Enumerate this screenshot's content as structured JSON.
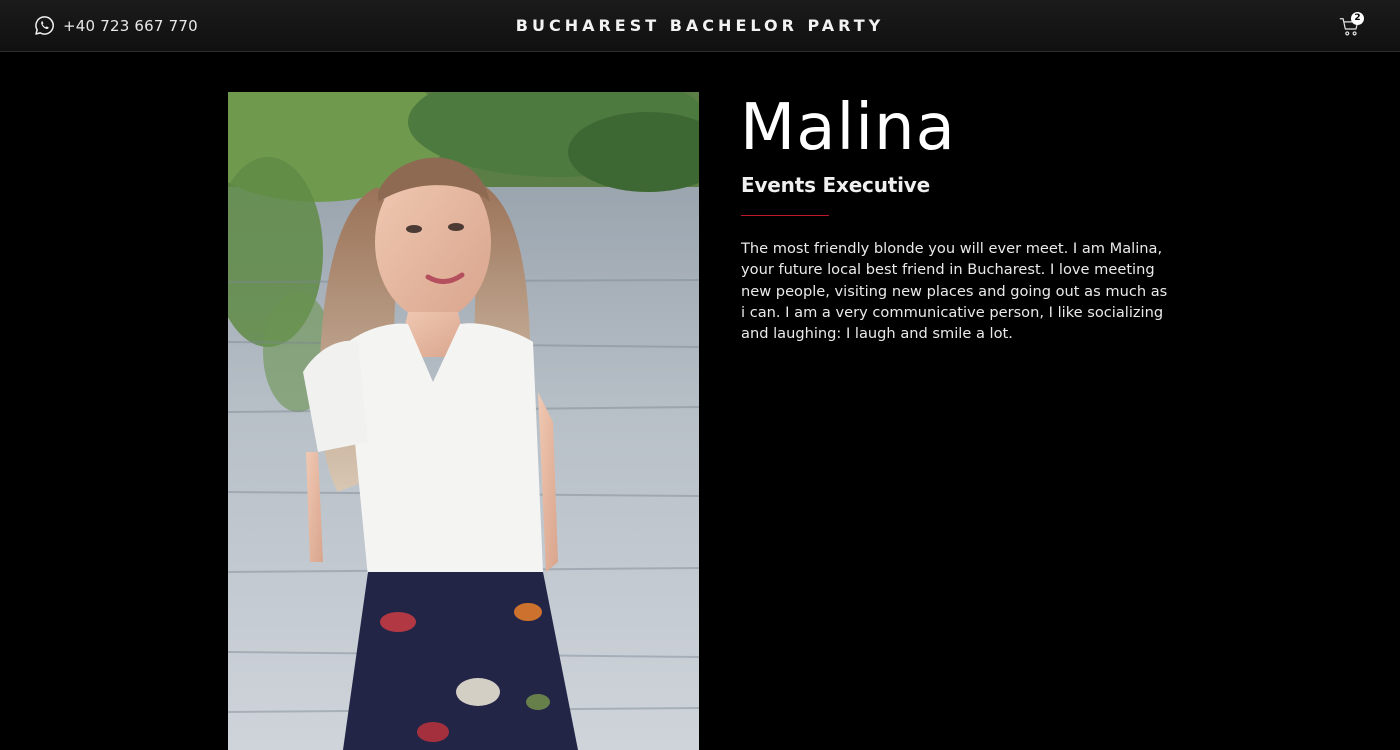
{
  "header": {
    "phone_icon": "whatsapp-icon",
    "phone": "+40 723 667 770",
    "brand": "BUCHAREST BACHELOR PARTY",
    "cart_icon": "shopping-cart-icon",
    "cart_count": "2"
  },
  "profile": {
    "name": "Malina",
    "role": "Events Executive",
    "bio": "The most friendly blonde you will ever meet. I am Malina, your future local best friend in Bucharest. I love meeting new people, visiting new places and going out as much as i can. I am a very communicative person, I like socializing and laughing: I laugh and smile a lot.",
    "photo": "portrait-photo"
  },
  "colors": {
    "background": "#000000",
    "accent_divider": "#c0182b",
    "text": "#ffffff"
  }
}
